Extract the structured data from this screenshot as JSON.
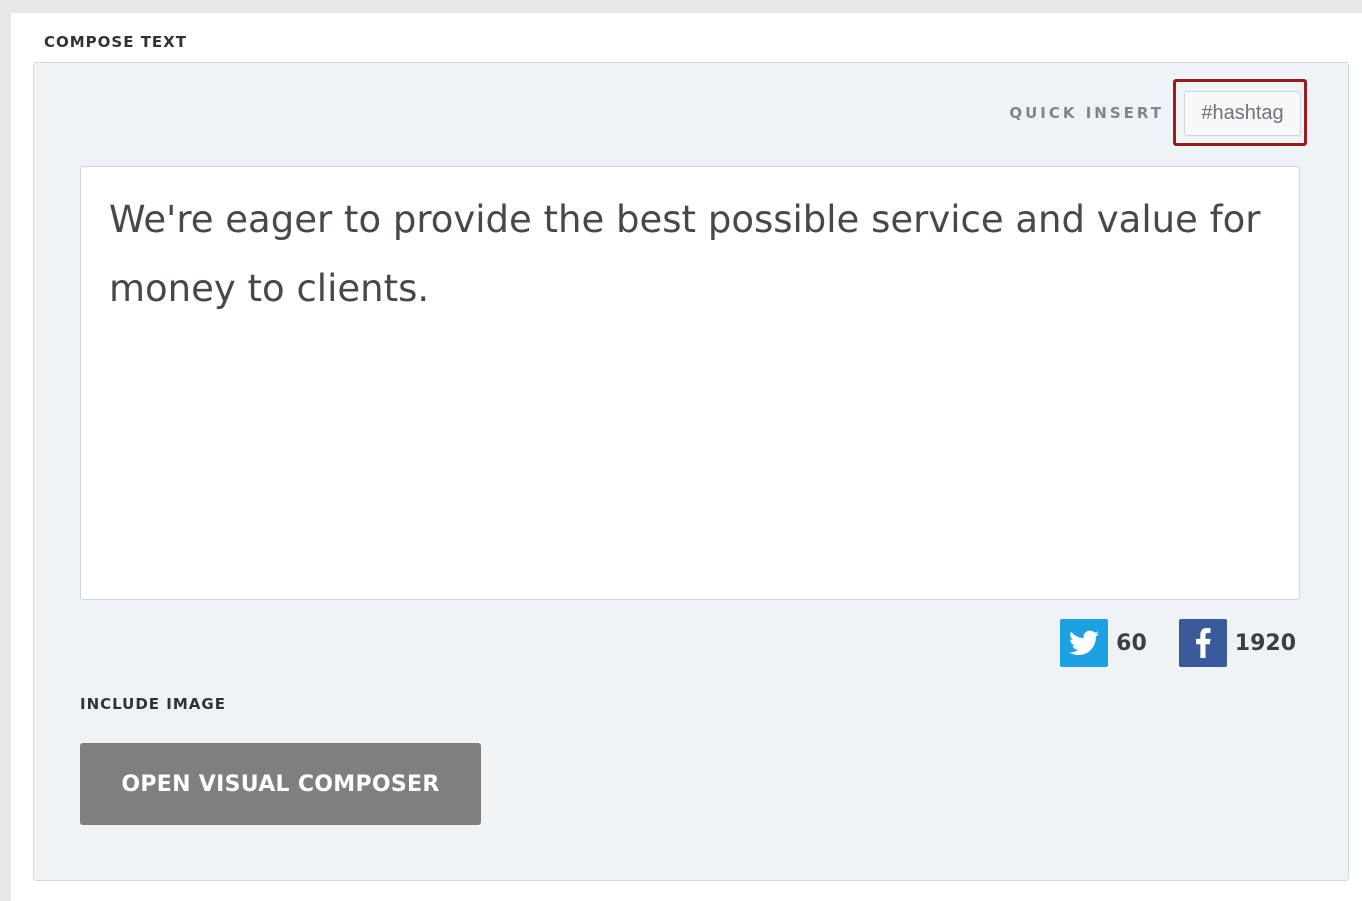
{
  "compose": {
    "section_label": "COMPOSE TEXT",
    "quick_insert_label": "QUICK INSERT",
    "hashtag_label": "#hashtag",
    "text": "We're eager to provide the best possible service and value for money to clients."
  },
  "counters": {
    "twitter": {
      "icon": "twitter-icon",
      "value": "60",
      "color": "#1da1e2"
    },
    "facebook": {
      "icon": "facebook-icon",
      "value": "1920",
      "color": "#3b5a9b"
    }
  },
  "image": {
    "section_label": "INCLUDE IMAGE",
    "composer_button_label": "OPEN VISUAL COMPOSER"
  },
  "colors": {
    "highlight_border": "#9b1c1f",
    "panel_background": "#f0f3f6",
    "button_background": "#7f7f7f"
  }
}
